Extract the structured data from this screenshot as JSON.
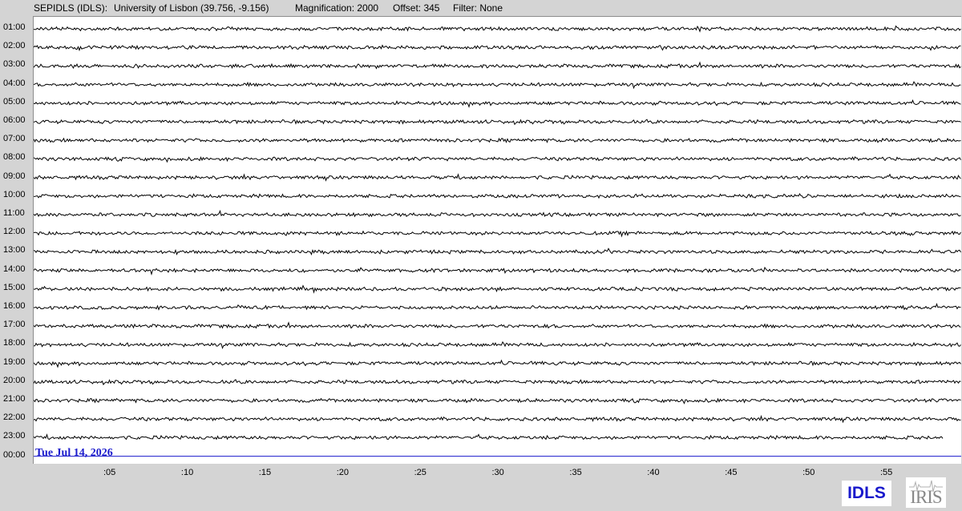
{
  "header": {
    "station": "SEPIDLS (IDLS):",
    "location": "University of Lisbon (39.756, -9.156)",
    "magnification": "Magnification: 2000",
    "offset": "Offset: 345",
    "filter": "Filter: None"
  },
  "hour_labels": [
    "01:00",
    "02:00",
    "03:00",
    "04:00",
    "05:00",
    "06:00",
    "07:00",
    "08:00",
    "09:00",
    "10:00",
    "11:00",
    "12:00",
    "13:00",
    "14:00",
    "15:00",
    "16:00",
    "17:00",
    "18:00",
    "19:00",
    "20:00",
    "21:00",
    "22:00",
    "23:00",
    "00:00"
  ],
  "minute_labels": [
    ":05",
    ":10",
    ":15",
    ":20",
    ":25",
    ":30",
    ":35",
    ":40",
    ":45",
    ":50",
    ":55"
  ],
  "date_label": "Tue Jul 14, 2026",
  "logos": {
    "idls": "IDLS",
    "iris": "IRIS"
  },
  "colors": {
    "trace": "#000000",
    "current_line": "#1a1acc",
    "date_text": "#1a1acc",
    "background": "#d4d4d4",
    "plot_background": "#ffffff"
  }
}
